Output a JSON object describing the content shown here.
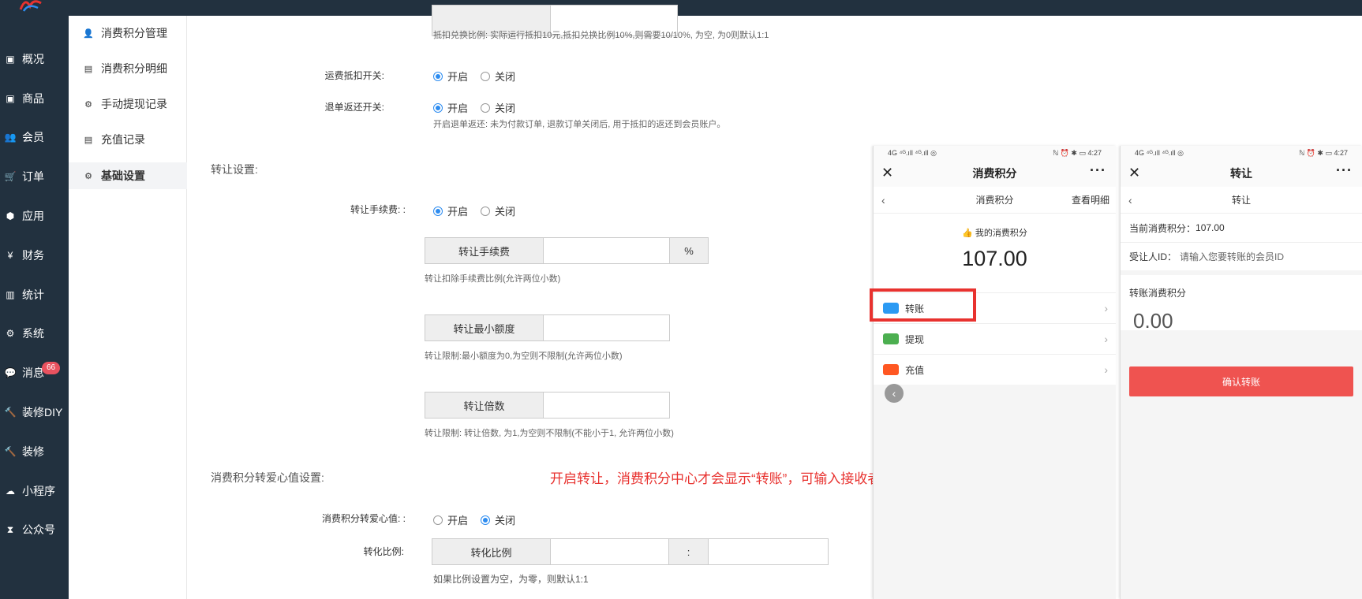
{
  "nav": {
    "items": [
      {
        "label": "概况",
        "icon": "inbox-icon"
      },
      {
        "label": "商品",
        "icon": "inbox-icon"
      },
      {
        "label": "会员",
        "icon": "users-icon"
      },
      {
        "label": "订单",
        "icon": "cart-icon"
      },
      {
        "label": "应用",
        "icon": "cubes-icon"
      },
      {
        "label": "财务",
        "icon": "yen-icon"
      },
      {
        "label": "统计",
        "icon": "bar-chart-icon"
      },
      {
        "label": "系统",
        "icon": "gears-icon"
      },
      {
        "label": "消息",
        "icon": "comment-icon"
      },
      {
        "label": "装修DIY",
        "icon": "gavel-icon"
      },
      {
        "label": "装修",
        "icon": "gavel-icon"
      },
      {
        "label": "小程序",
        "icon": "wechat-icon"
      },
      {
        "label": "公众号",
        "icon": "hourglass-icon"
      }
    ],
    "message_badge": "66"
  },
  "subnav": {
    "items": [
      {
        "label": "消费积分管理",
        "icon": "user-icon"
      },
      {
        "label": "消费积分明细",
        "icon": "file-icon"
      },
      {
        "label": "手动提现记录",
        "icon": "gears-icon"
      },
      {
        "label": "充值记录",
        "icon": "file-icon"
      },
      {
        "label": "基础设置",
        "icon": "gears-icon",
        "active": true
      }
    ]
  },
  "form": {
    "deduct_ratio_hint": "抵扣兑换比例: 实际运行抵扣10元,抵扣兑换比例10%,则需要10/10%, 为空, 为0则默认1:1",
    "freight_label": "运费抵扣开关:",
    "refund_label": "退单返还开关:",
    "refund_hint": "开启退单返还: 未为付款订单, 退款订单关闭后, 用于抵扣的返还到会员账户。",
    "open": "开启",
    "close": "关闭",
    "transfer_section": "转让设置:",
    "transfer_fee_label": "转让手续费: :",
    "transfer_fee_addon": "转让手续费",
    "percent": "%",
    "transfer_fee_hint": "转让扣除手续费比例(允许两位小数)",
    "transfer_min_addon": "转让最小额度",
    "transfer_min_hint": "转让限制:最小额度为0,为空则不限制(允许两位小数)",
    "transfer_multiple_addon": "转让倍数",
    "transfer_multiple_hint": "转让限制: 转让倍数, 为1,为空则不限制(不能小于1, 允许两位小数)",
    "love_section": "消费积分转爱心值设置:",
    "love_label": "消费积分转爱心值: :",
    "ratio_label": "转化比例:",
    "ratio_addon": "转化比例",
    "colon": ":",
    "ratio_hint": "如果比例设置为空，为零，则默认1:1"
  },
  "annotation": "开启转让，消费积分中心才会显示“转账”，可输入接收者的会员id",
  "phone_left": {
    "status_left": "4G ⁴ᴳ.ıll ⁴ᴳ.ıll ◎",
    "status_right": "ℕ ⏰ ✱ ▭ 4:27",
    "title": "消费积分",
    "sub_title": "消费积分",
    "detail_link": "查看明细",
    "balance_label": "我的消费积分",
    "balance": "107.00",
    "menu": [
      "转账",
      "提现",
      "充值"
    ]
  },
  "phone_right": {
    "status_left": "4G ⁴ᴳ.ıll ⁴ᴳ.ıll ◎",
    "status_right": "ℕ ⏰ ✱ ▭ 4:27",
    "title": "转让",
    "sub_title": "转让",
    "current_label": "当前消费积分：",
    "current_value": "107.00",
    "recipient_label": "受让人ID：",
    "recipient_placeholder": "请输入您要转账的会员ID",
    "amount_label": "转账消费积分",
    "amount_value": "0.00",
    "confirm": "确认转账"
  },
  "colors": {
    "sidebar": "#22313f",
    "accent": "#2d8cf0",
    "annotation": "#e8322f",
    "confirm": "#ef5350"
  }
}
